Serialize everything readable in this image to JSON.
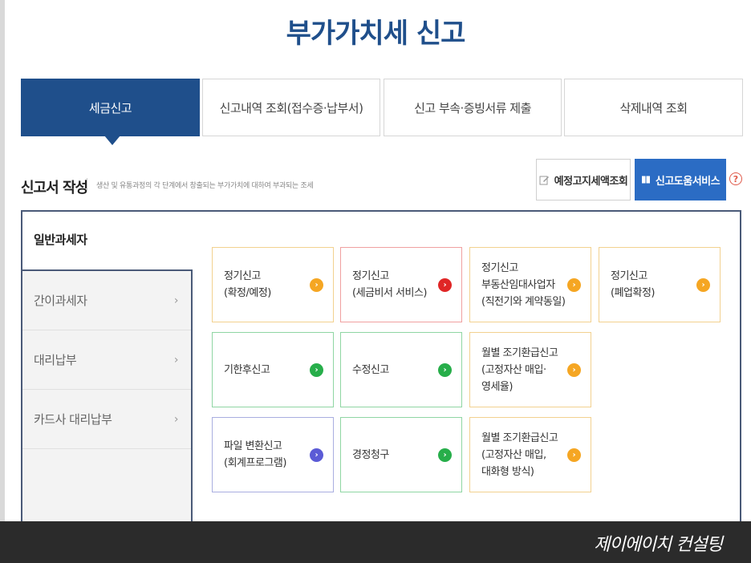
{
  "page": {
    "title": "부가가치세 신고"
  },
  "tabs": [
    {
      "label": "세금신고",
      "active": true
    },
    {
      "label": "신고내역 조회(접수증·납부서)"
    },
    {
      "label": "신고 부속·증빙서류 제출"
    },
    {
      "label": "삭제내역 조회"
    }
  ],
  "section": {
    "title": "신고서 작성",
    "description": "생산 및 유통과정의 각 단계에서 창출되는 부가가치에 대하여 부과되는 조세"
  },
  "actions": {
    "lookup_label": "예정고지세액조회",
    "help_label": "신고도움서비스",
    "help_icon": "?"
  },
  "sidebar": {
    "items": [
      {
        "label": "일반과세자",
        "active": true
      },
      {
        "label": "간이과세자",
        "chevron": "›"
      },
      {
        "label": "대리납부",
        "chevron": "›"
      },
      {
        "label": "카드사 대리납부",
        "chevron": "›"
      }
    ]
  },
  "cards": [
    {
      "lines": [
        "정기신고",
        "(확정/예정)"
      ],
      "color": "#f5a623"
    },
    {
      "lines": [
        "정기신고",
        "(세금비서 서비스)"
      ],
      "color": "#e02626"
    },
    {
      "lines": [
        "정기신고",
        "부동산임대사업자",
        "(직전기와 계약동일)"
      ],
      "color": "#f5a623"
    },
    {
      "lines": [
        "정기신고",
        "(폐업확정)"
      ],
      "color": "#f5a623"
    },
    {
      "lines": [
        "기한후신고"
      ],
      "color": "#27ae4a"
    },
    {
      "lines": [
        "수정신고"
      ],
      "color": "#27ae4a"
    },
    {
      "lines": [
        "월별 조기환급신고",
        "(고정자산 매입·",
        "영세율)"
      ],
      "color": "#f5a623"
    },
    {
      "lines": [
        "파일 변환신고",
        "(회계프로그램)"
      ],
      "color": "#5b5bd6"
    },
    {
      "lines": [
        "경정청구"
      ],
      "color": "#27ae4a"
    },
    {
      "lines": [
        "월별 조기환급신고",
        "(고정자산 매입,",
        "대화형 방식)"
      ],
      "color": "#f5a623"
    }
  ],
  "footer": {
    "brand": "제이에이치 컨설팅"
  }
}
